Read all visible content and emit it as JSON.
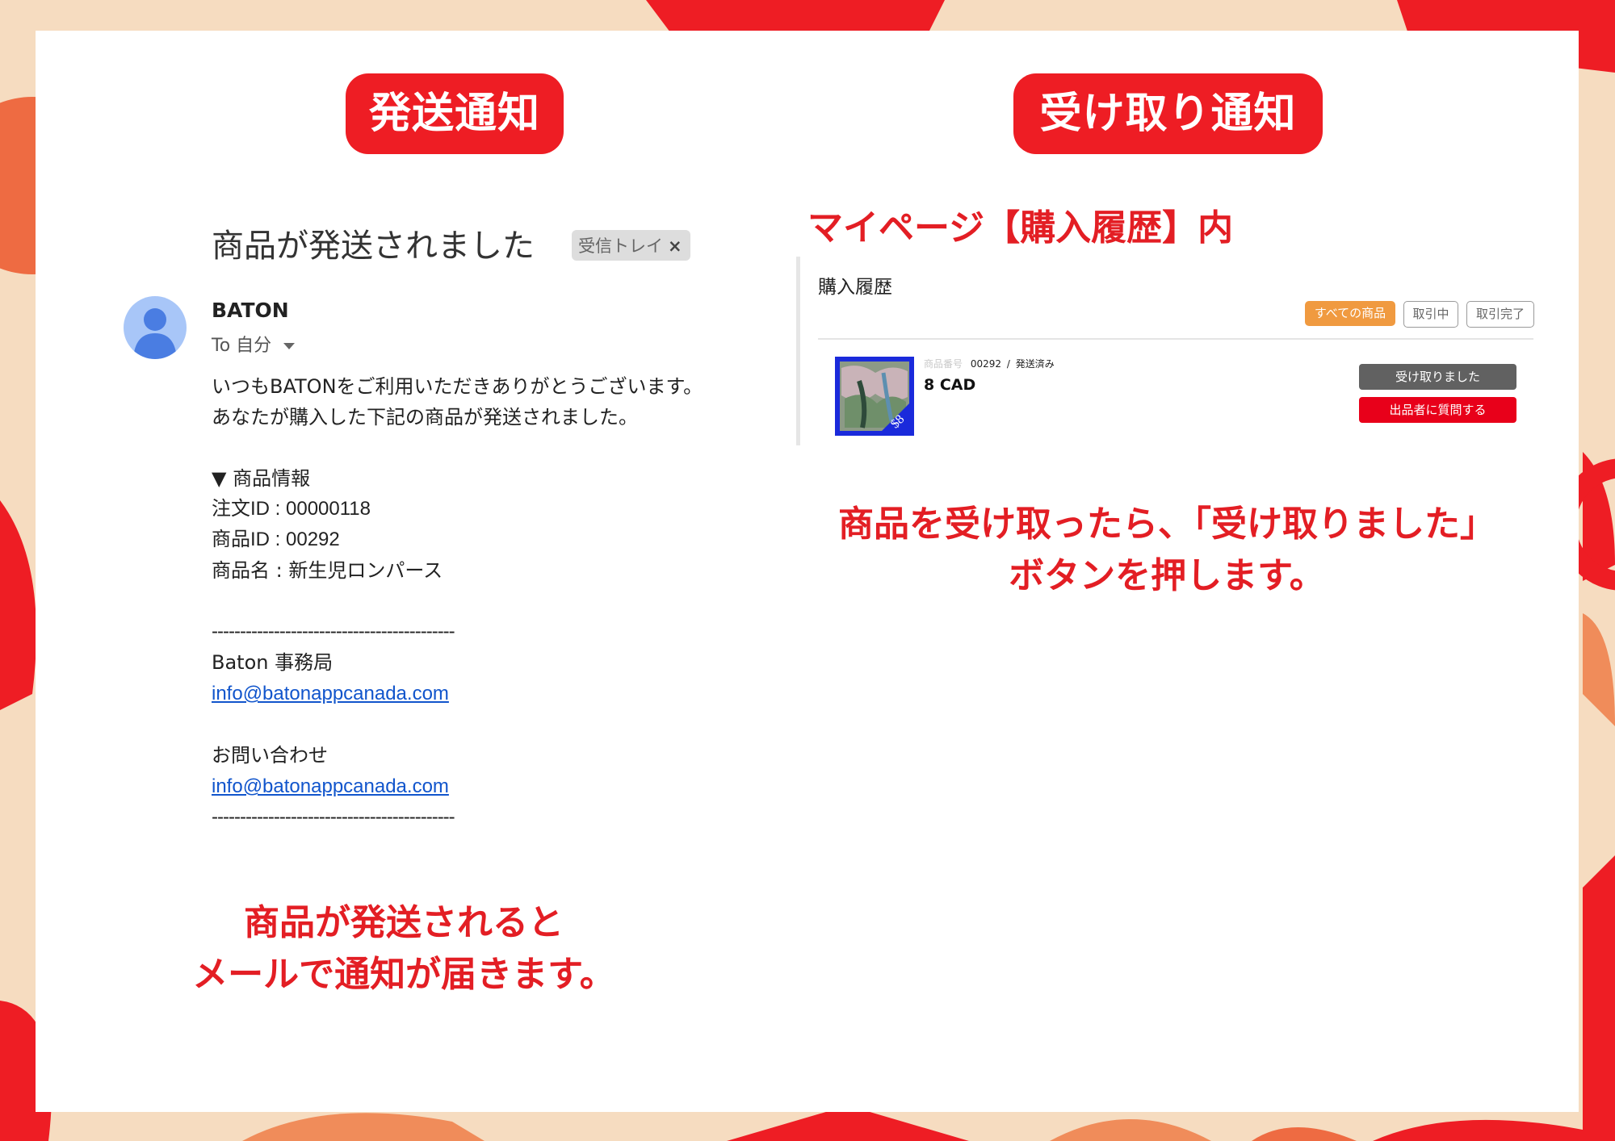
{
  "colors": {
    "accent_red": "#ee1d24",
    "orange": "#f09a40",
    "link_blue": "#1155cc",
    "dark_gray": "#616161"
  },
  "left": {
    "badge": "発送通知",
    "email": {
      "subject": "商品が発送されました",
      "label_tag": "受信トレイ",
      "label_close": "×",
      "sender": "BATON",
      "to": "To 自分",
      "greeting": "いつもBATONをご利用いただきありがとうございます。",
      "message": "あなたが購入した下記の商品が発送されました。",
      "info_heading": "▼ 商品情報",
      "order_id": "注文ID : 00000118",
      "product_id": "商品ID : 00292",
      "product_name": "商品名 : 新生児ロンパース",
      "divider": "-------------------------------------------",
      "office": "Baton 事務局",
      "email1": "info@batonappcanada.com",
      "contact": "お問い合わせ",
      "email2": "info@batonappcanada.com"
    },
    "caption_line1": "商品が発送されると",
    "caption_line2": "メールで通知が届きます。"
  },
  "right": {
    "badge": "受け取り通知",
    "subheading": "マイページ【購入履歴】内",
    "purchase_history": {
      "title": "購入履歴",
      "tabs": [
        "すべての商品",
        "取引中",
        "取引完了"
      ],
      "item": {
        "number_label": "商品番号",
        "number": "00292",
        "separator": "/",
        "status": "発送済み",
        "price": "8 CAD",
        "thumb_badge": "$8"
      },
      "received_button": "受け取りました",
      "ask_seller_button": "出品者に質問する"
    },
    "caption_line1": "商品を受け取ったら、「受け取りました」",
    "caption_line2": "ボタンを押します。"
  }
}
